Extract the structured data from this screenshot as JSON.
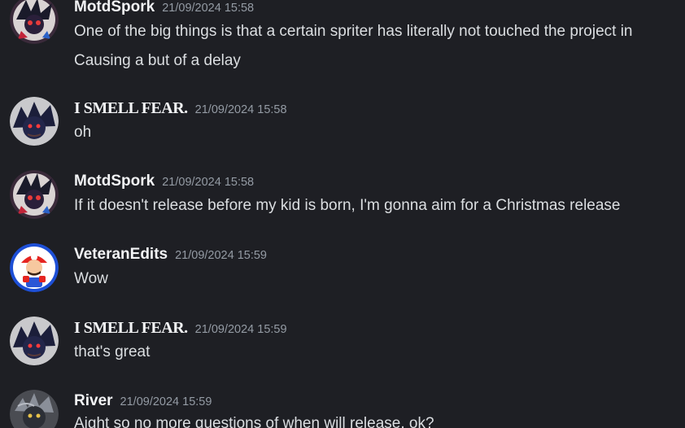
{
  "messages": [
    {
      "author": "MotdSpork",
      "timestamp": "21/09/2024 15:58",
      "lines": [
        "One of the big things is that a certain spriter has literally not touched the project in",
        "Causing a but of a delay"
      ],
      "avatar_icon": "spork-avatar-icon"
    },
    {
      "author": "I SMELL FEAR.",
      "timestamp": "21/09/2024 15:58",
      "lines": [
        "oh"
      ],
      "avatar_icon": "dark-hedgehog-avatar-icon"
    },
    {
      "author": "MotdSpork",
      "timestamp": "21/09/2024 15:58",
      "lines": [
        "If it doesn't release before my kid is born, I'm gonna aim for a Christmas release"
      ],
      "avatar_icon": "spork-avatar-icon"
    },
    {
      "author": "VeteranEdits",
      "timestamp": "21/09/2024 15:59",
      "lines": [
        "Wow"
      ],
      "avatar_icon": "mario-avatar-icon"
    },
    {
      "author": "I SMELL FEAR.",
      "timestamp": "21/09/2024 15:59",
      "lines": [
        "that's great"
      ],
      "avatar_icon": "dark-hedgehog-avatar-icon"
    },
    {
      "author": "River",
      "timestamp": "21/09/2024 15:59",
      "lines": [
        "Aight so no more questions of when will release, ok?"
      ],
      "avatar_icon": "river-avatar-icon"
    }
  ],
  "colors": {
    "background": "#1e1f24",
    "author": "#f2f3f5",
    "timestamp": "#949ba4",
    "text": "#dbdee1"
  }
}
